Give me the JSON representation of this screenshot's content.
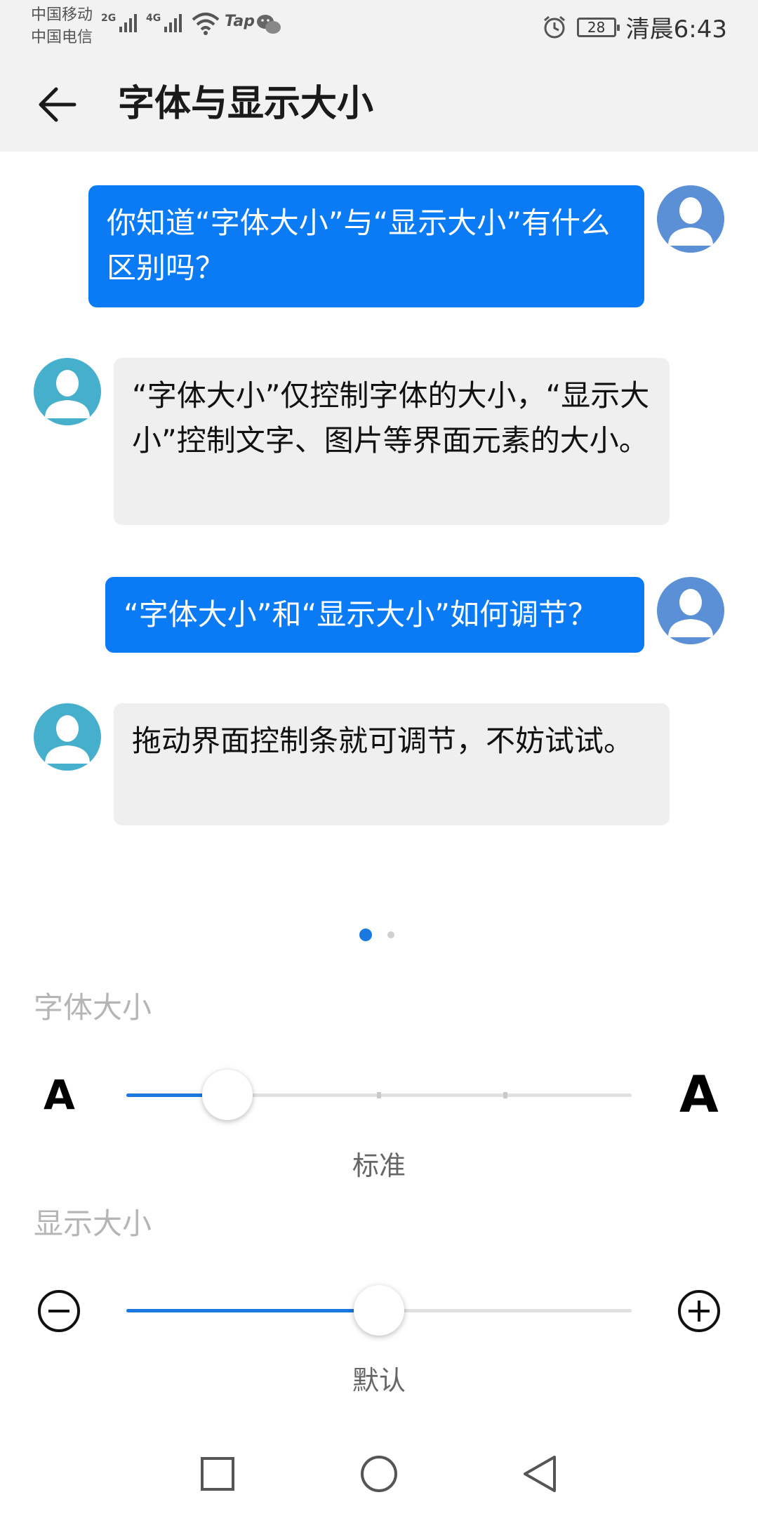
{
  "status_bar": {
    "carrier_1": "中国移动",
    "carrier_2": "中国电信",
    "net_1": "2G",
    "net_2": "4G",
    "tap": "Tap",
    "battery": "28",
    "time": "清晨6:43"
  },
  "header": {
    "title": "字体与显示大小"
  },
  "chat": [
    {
      "from": "me",
      "text": "你知道“字体大小”与“显示大小”有什么区别吗？"
    },
    {
      "from": "bot",
      "text": "“字体大小”仅控制字体的大小，“显示大小”控制文字、图片等界面元素的大小。"
    },
    {
      "from": "me",
      "text": "“字体大小”和“显示大小”如何调节？"
    },
    {
      "from": "bot",
      "text": "拖动界面控制条就可调节，不妨试试。"
    }
  ],
  "pager": {
    "current": 1,
    "total": 2
  },
  "font_size": {
    "label": "字体大小",
    "small_glyph": "A",
    "large_glyph": "A",
    "value_label": "标准",
    "level": 2,
    "steps": 5
  },
  "display_size": {
    "label": "显示大小",
    "value_label": "默认",
    "fraction": 0.5
  },
  "colors": {
    "accent": "#0A7BF5",
    "bubble_me": "#0A7BF5",
    "bubble_bot": "#EFEFEF",
    "label_gray": "#B5B5B5"
  },
  "icons": [
    "back-arrow-icon",
    "minus-circle-icon",
    "plus-circle-icon",
    "recent-apps-icon",
    "home-icon",
    "back-triangle-icon",
    "alarm-icon",
    "wifi-icon",
    "wechat-icon"
  ]
}
